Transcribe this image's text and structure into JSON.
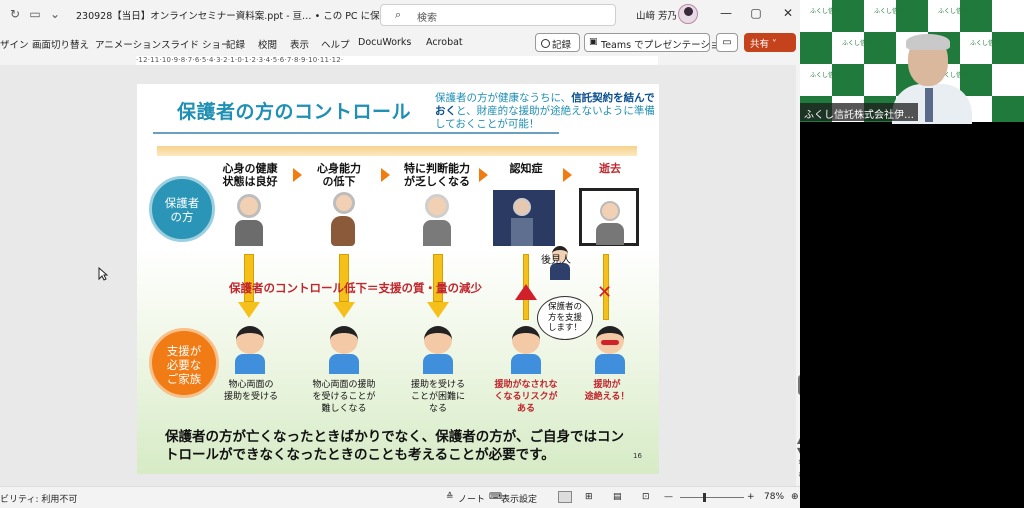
{
  "titlebar": {
    "doc_title": "230928【当日】オンラインセミナー資料案.ppt",
    "suffix": " - 亘…   • この PC に保存済み ˅",
    "search_placeholder": "検索",
    "user_name": "山﨑 芳乃"
  },
  "menu": {
    "items": [
      "ザイン",
      "画面切り替え",
      "アニメーション",
      "スライド ショー",
      "記録",
      "校閲",
      "表示",
      "ヘルプ",
      "DocuWorks",
      "Acrobat"
    ],
    "record_label": "記録",
    "teams_label": "Teams でプレゼンテーション",
    "share_label": "共有 ˅"
  },
  "ruler": {
    "ticks": "·12·11·10·9·8·7·6·5·4·3·2·1·0·1·2·3·4·5·6·7·8·9·10·11·12·"
  },
  "status": {
    "accessibility": "ビリティ: 利用不可",
    "notes": "ノート",
    "view_settings": "表示設定",
    "zoom": "78%"
  },
  "slide": {
    "title": "保護者の方のコントロール",
    "intro_1": "保護者の方が健康なうちに、",
    "intro_bold": "信託契約を結んでおく",
    "intro_2": "と、財産的な援助が途絶えないように準備しておくことが可能！",
    "circle_guardian": "保護者の方",
    "circle_family": "支援が必要なご家族",
    "stages": [
      "心身の健康\n状態は良好",
      "心身能力\nの低下",
      "特に判断能力\nが乏しくなる",
      "認知症",
      "逝去"
    ],
    "control_text": "保護者のコントロール低下＝支援の質・量の減少",
    "guardian_label": "後見人",
    "bubble": "保護者の\n方を支援\nします！",
    "captions": [
      "物心両面の\n援助を受ける",
      "物心両面の援助\nを受けることが\n難しくなる",
      "援助を受ける\nことが困難に\nなる",
      "援助がなされな\nくなるリスクが\nある",
      "援助が\n途絶える！"
    ],
    "bottom_text": "保護者の方が亡くなったときばかりでなく、保護者の方が、ご自身ではコントロールができなくなったときのことも考えることが必要です。",
    "slide_number": "16"
  },
  "video": {
    "caption": "ふくし信託株式会社伊…",
    "brand_tile": "ふくし信託"
  },
  "colors": {
    "accent_teal": "#1f8fb4",
    "orange": "#f17b14",
    "red": "#c0262d",
    "share": "#c4421c"
  }
}
